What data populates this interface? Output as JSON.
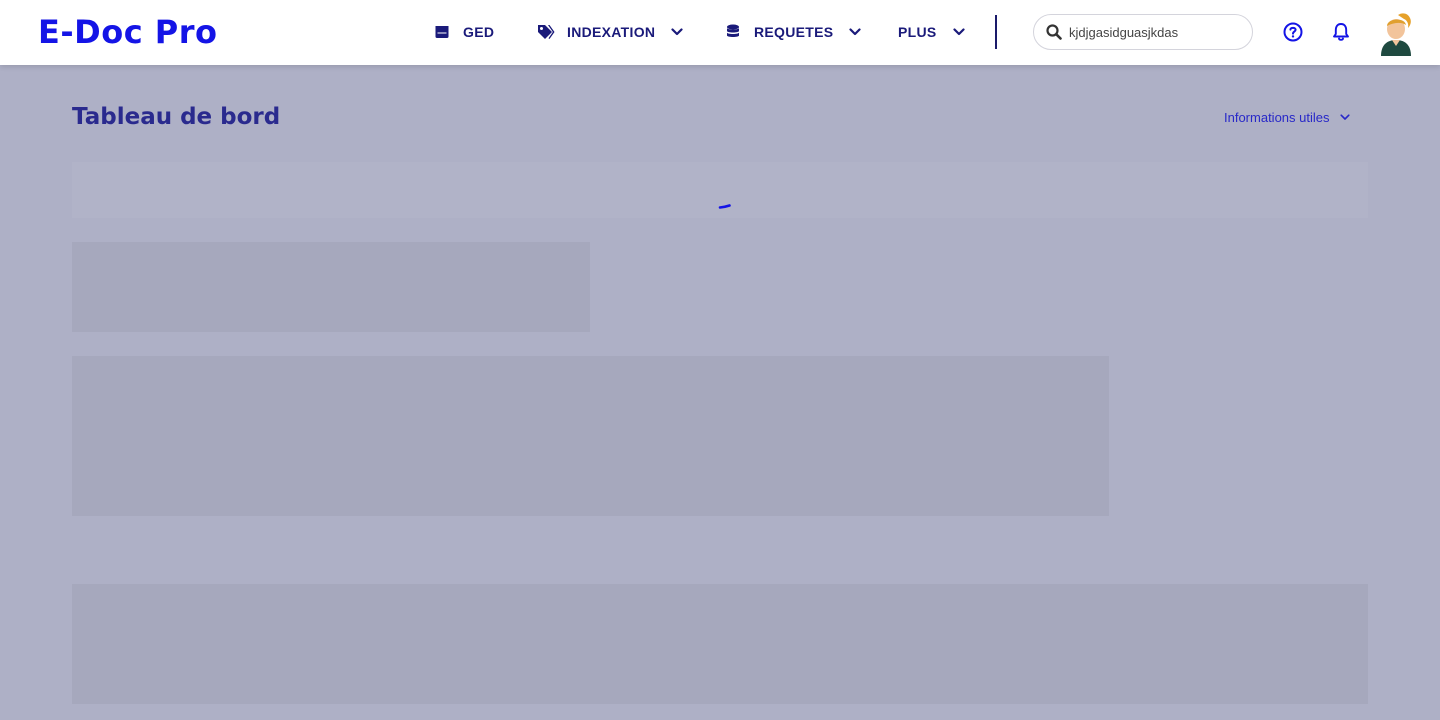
{
  "app": {
    "logo": "E-Doc Pro"
  },
  "nav": {
    "items": [
      {
        "label": "GED",
        "icon": "archive-box-icon",
        "has_dropdown": false
      },
      {
        "label": "INDEXATION",
        "icon": "tags-icon",
        "has_dropdown": true
      },
      {
        "label": "REQUETES",
        "icon": "database-icon",
        "has_dropdown": true
      },
      {
        "label": "PLUS",
        "icon": "",
        "has_dropdown": true
      }
    ]
  },
  "search": {
    "value": "kjdjgasidguasjkdas",
    "icon": "search-icon"
  },
  "header_icons": [
    "help-circle-icon",
    "bell-icon",
    "avatar"
  ],
  "page": {
    "title": "Tableau de bord",
    "info_link": "Informations utiles",
    "loading": true
  },
  "colors": {
    "brand": "#1414e6",
    "nav_text": "#1a1a7a",
    "title": "#2a2a8e",
    "link": "#2828c8",
    "overlay": "#aeb0c6",
    "skeleton": "#a6a8bd"
  }
}
